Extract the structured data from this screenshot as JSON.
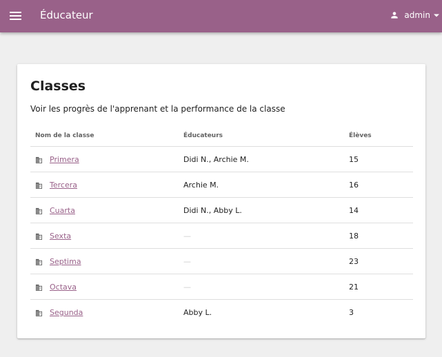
{
  "app": {
    "title": "Éducateur",
    "user": "admin",
    "accent": "#996189"
  },
  "page": {
    "title": "Classes",
    "subtitle": "Voir les progrès de l'apprenant et la performance de la classe"
  },
  "table": {
    "headers": {
      "name": "Nom de la classe",
      "educators": "Éducateurs",
      "learners": "Élèves"
    },
    "rows": [
      {
        "name": "Primera",
        "educators": "Didi N., Archie M.",
        "learners": "15"
      },
      {
        "name": "Tercera",
        "educators": "Archie M.",
        "learners": "16"
      },
      {
        "name": "Cuarta",
        "educators": "Didi N., Abby L.",
        "learners": "14"
      },
      {
        "name": "Sexta",
        "educators": "—",
        "learners": "18"
      },
      {
        "name": "Septima",
        "educators": "—",
        "learners": "23"
      },
      {
        "name": "Octava",
        "educators": "—",
        "learners": "21"
      },
      {
        "name": "Segunda",
        "educators": "Abby L.",
        "learners": "3"
      }
    ]
  }
}
